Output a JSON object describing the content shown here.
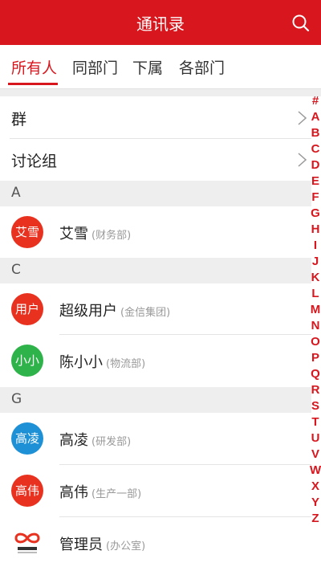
{
  "header": {
    "title": "通讯录"
  },
  "tabs": [
    {
      "label": "所有人",
      "active": true
    },
    {
      "label": "同部门"
    },
    {
      "label": "下属"
    },
    {
      "label": "各部门"
    }
  ],
  "groups": [
    {
      "label": "群"
    },
    {
      "label": "讨论组"
    }
  ],
  "sections": [
    {
      "letter": "A",
      "contacts": [
        {
          "avatar": "艾雪",
          "avatar_color": "#e8321f",
          "name": "艾雪",
          "dept": "(财务部)"
        }
      ]
    },
    {
      "letter": "C",
      "contacts": [
        {
          "avatar": "用户",
          "avatar_color": "#e8321f",
          "name": "超级用户",
          "dept": "(金信集团)"
        },
        {
          "avatar": "小小",
          "avatar_color": "#2eb34a",
          "name": "陈小小",
          "dept": "(物流部)"
        }
      ]
    },
    {
      "letter": "G",
      "contacts": [
        {
          "avatar": "高凌",
          "avatar_color": "#1e90d6",
          "name": "高凌",
          "dept": "(研发部)"
        },
        {
          "avatar": "高伟",
          "avatar_color": "#e8321f",
          "name": "高伟",
          "dept": "(生产一部)"
        },
        {
          "avatar": "华天动力",
          "avatar_icon": "infinity-logo-icon",
          "name": "管理员",
          "dept": "(办公室)"
        }
      ]
    }
  ],
  "index_letters": [
    "#",
    "A",
    "B",
    "C",
    "D",
    "E",
    "F",
    "G",
    "H",
    "I",
    "J",
    "K",
    "L",
    "M",
    "N",
    "O",
    "P",
    "Q",
    "R",
    "S",
    "T",
    "U",
    "V",
    "W",
    "X",
    "Y",
    "Z"
  ],
  "colors": {
    "accent": "#d7161d"
  }
}
